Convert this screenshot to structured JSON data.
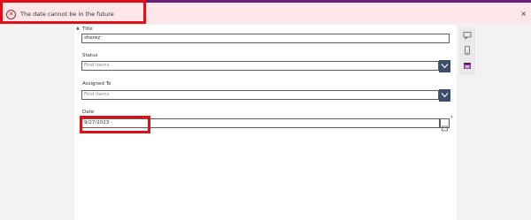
{
  "banner": {
    "message": "The date cannot be in the future",
    "icon": "error-circle-icon",
    "close_glyph": "×",
    "error_glyph": "✕"
  },
  "form": {
    "title": {
      "label": "Title",
      "value": "sherez"
    },
    "status": {
      "label": "Status",
      "placeholder": "Find items"
    },
    "assigned_to": {
      "label": "Assigned To",
      "placeholder": "Find items"
    },
    "date": {
      "label": "Date",
      "value": "9/27/2023",
      "required_marker": "*"
    }
  },
  "rail": {
    "icons": [
      "comment-icon",
      "phone-icon",
      "calendar-icon"
    ]
  },
  "colors": {
    "accent": "#6a1f7a",
    "error_bg": "#fde7e9",
    "error_outline": "#e10d17",
    "dropdown_button": "#3b4e6b"
  }
}
